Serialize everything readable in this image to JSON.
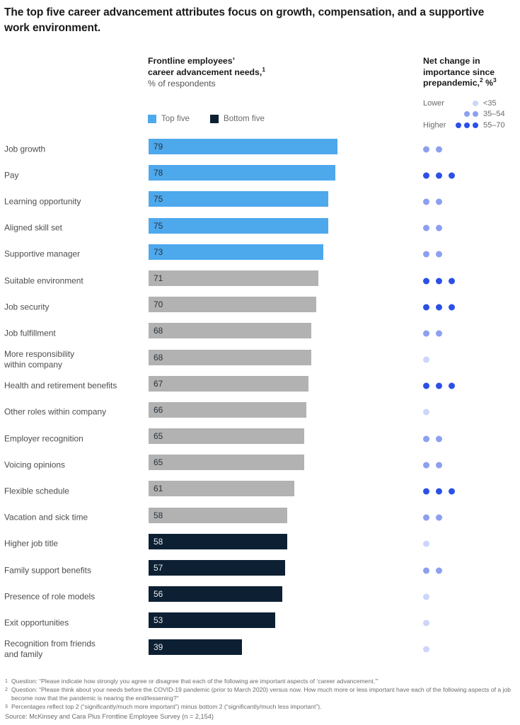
{
  "title": "The top five career advancement attributes focus on growth, compensation, and a supportive work environment.",
  "headers": {
    "bars_line1": "Frontline employees’",
    "bars_line2": "career advancement needs,",
    "bars_line2_sup": "1",
    "bars_sub": "% of respondents",
    "dots_line1": "Net change in",
    "dots_line2": "importance since",
    "dots_line3": "prepandemic,",
    "dots_line3_sup": "2",
    "dots_line3_pct": "%",
    "dots_line3_sup2": "3"
  },
  "dot_legend": {
    "lower_label": "Lower",
    "higher_label": "Higher",
    "entries": [
      {
        "label": "<35",
        "count": 1,
        "tone": "light"
      },
      {
        "label": "35–54",
        "count": 2,
        "tone": "medium"
      },
      {
        "label": "55–70",
        "count": 3,
        "tone": "dark"
      }
    ]
  },
  "bar_legend": [
    {
      "label": "Top five",
      "color": "#4ea8ec"
    },
    {
      "label": "Bottom five",
      "color": "#0d2033"
    }
  ],
  "colors": {
    "top_five": "#4ea8ec",
    "middle": "#b2b2b2",
    "bottom_five": "#0d2033",
    "dot_light": "#cdd6f9",
    "dot_medium": "#8c9ff0",
    "dot_dark": "#2b50e8"
  },
  "chart_data": {
    "type": "bar",
    "title": "The top five career advancement attributes focus on growth, compensation, and a supportive work environment.",
    "xlabel": "% of respondents",
    "ylabel": "",
    "xlim": [
      0,
      100
    ],
    "grid": false,
    "legend_position": "top-left",
    "categories": [
      "Job growth",
      "Pay",
      "Learning opportunity",
      "Aligned skill set",
      "Supportive manager",
      "Suitable environment",
      "Job security",
      "Job fulfillment",
      "More responsibility within company",
      "Health and retirement benefits",
      "Other roles within company",
      "Employer recognition",
      "Voicing opinions",
      "Flexible schedule",
      "Vacation and sick time",
      "Higher job title",
      "Family support benefits",
      "Presence of role models",
      "Exit opportunities",
      "Recognition from friends and family"
    ],
    "values": [
      79,
      78,
      75,
      75,
      73,
      71,
      70,
      68,
      68,
      67,
      66,
      65,
      65,
      61,
      58,
      58,
      57,
      56,
      53,
      39
    ],
    "series": [
      {
        "name": "Frontline employees' career advancement needs, % of respondents",
        "values": [
          79,
          78,
          75,
          75,
          73,
          71,
          70,
          68,
          68,
          67,
          66,
          65,
          65,
          61,
          58,
          58,
          57,
          56,
          53,
          39
        ]
      },
      {
        "name": "Net change in importance since prepandemic, % (dot count)",
        "values": [
          2,
          3,
          2,
          2,
          2,
          3,
          3,
          2,
          1,
          3,
          1,
          2,
          2,
          3,
          2,
          1,
          2,
          1,
          1,
          1
        ]
      }
    ]
  },
  "rows": [
    {
      "label": "Job growth",
      "value": 79,
      "group": "top",
      "dots": 2,
      "tone": "medium"
    },
    {
      "label": "Pay",
      "value": 78,
      "group": "top",
      "dots": 3,
      "tone": "dark"
    },
    {
      "label": "Learning opportunity",
      "value": 75,
      "group": "top",
      "dots": 2,
      "tone": "medium"
    },
    {
      "label": "Aligned skill set",
      "value": 75,
      "group": "top",
      "dots": 2,
      "tone": "medium"
    },
    {
      "label": "Supportive manager",
      "value": 73,
      "group": "top",
      "dots": 2,
      "tone": "medium"
    },
    {
      "label": "Suitable environment",
      "value": 71,
      "group": "mid",
      "dots": 3,
      "tone": "dark"
    },
    {
      "label": "Job security",
      "value": 70,
      "group": "mid",
      "dots": 3,
      "tone": "dark"
    },
    {
      "label": "Job fulfillment",
      "value": 68,
      "group": "mid",
      "dots": 2,
      "tone": "medium"
    },
    {
      "label": "More responsibility\nwithin company",
      "value": 68,
      "group": "mid",
      "dots": 1,
      "tone": "light"
    },
    {
      "label": "Health and retirement benefits",
      "value": 67,
      "group": "mid",
      "dots": 3,
      "tone": "dark"
    },
    {
      "label": "Other roles within company",
      "value": 66,
      "group": "mid",
      "dots": 1,
      "tone": "light"
    },
    {
      "label": "Employer recognition",
      "value": 65,
      "group": "mid",
      "dots": 2,
      "tone": "medium"
    },
    {
      "label": "Voicing opinions",
      "value": 65,
      "group": "mid",
      "dots": 2,
      "tone": "medium"
    },
    {
      "label": "Flexible schedule",
      "value": 61,
      "group": "mid",
      "dots": 3,
      "tone": "dark"
    },
    {
      "label": "Vacation and sick time",
      "value": 58,
      "group": "mid",
      "dots": 2,
      "tone": "medium"
    },
    {
      "label": "Higher job title",
      "value": 58,
      "group": "bottom",
      "dots": 1,
      "tone": "light"
    },
    {
      "label": "Family support benefits",
      "value": 57,
      "group": "bottom",
      "dots": 2,
      "tone": "medium"
    },
    {
      "label": "Presence of role models",
      "value": 56,
      "group": "bottom",
      "dots": 1,
      "tone": "light"
    },
    {
      "label": "Exit opportunities",
      "value": 53,
      "group": "bottom",
      "dots": 1,
      "tone": "light"
    },
    {
      "label": "Recognition from friends\nand family",
      "value": 39,
      "group": "bottom",
      "dots": 1,
      "tone": "light"
    }
  ],
  "footnotes": [
    {
      "marker": "1",
      "text": "Question: “Please indicate how strongly you agree or disagree that each of the following are important aspects of ‘career advancement.’”"
    },
    {
      "marker": "2",
      "text": "Question: “Please think about your needs before the COVID-19 pandemic (prior to March 2020) versus now. How much more or less important have each of the following aspects of a job become now that the pandemic is nearing the end/lessening?”"
    },
    {
      "marker": "3",
      "text": "Percentages reflect top 2 (“significantly/much more important”) minus bottom 2 (“significantly/much less important”)."
    }
  ],
  "source": "Source: McKinsey and Cara Plus Frontline Employee Survey (n = 2,154)"
}
